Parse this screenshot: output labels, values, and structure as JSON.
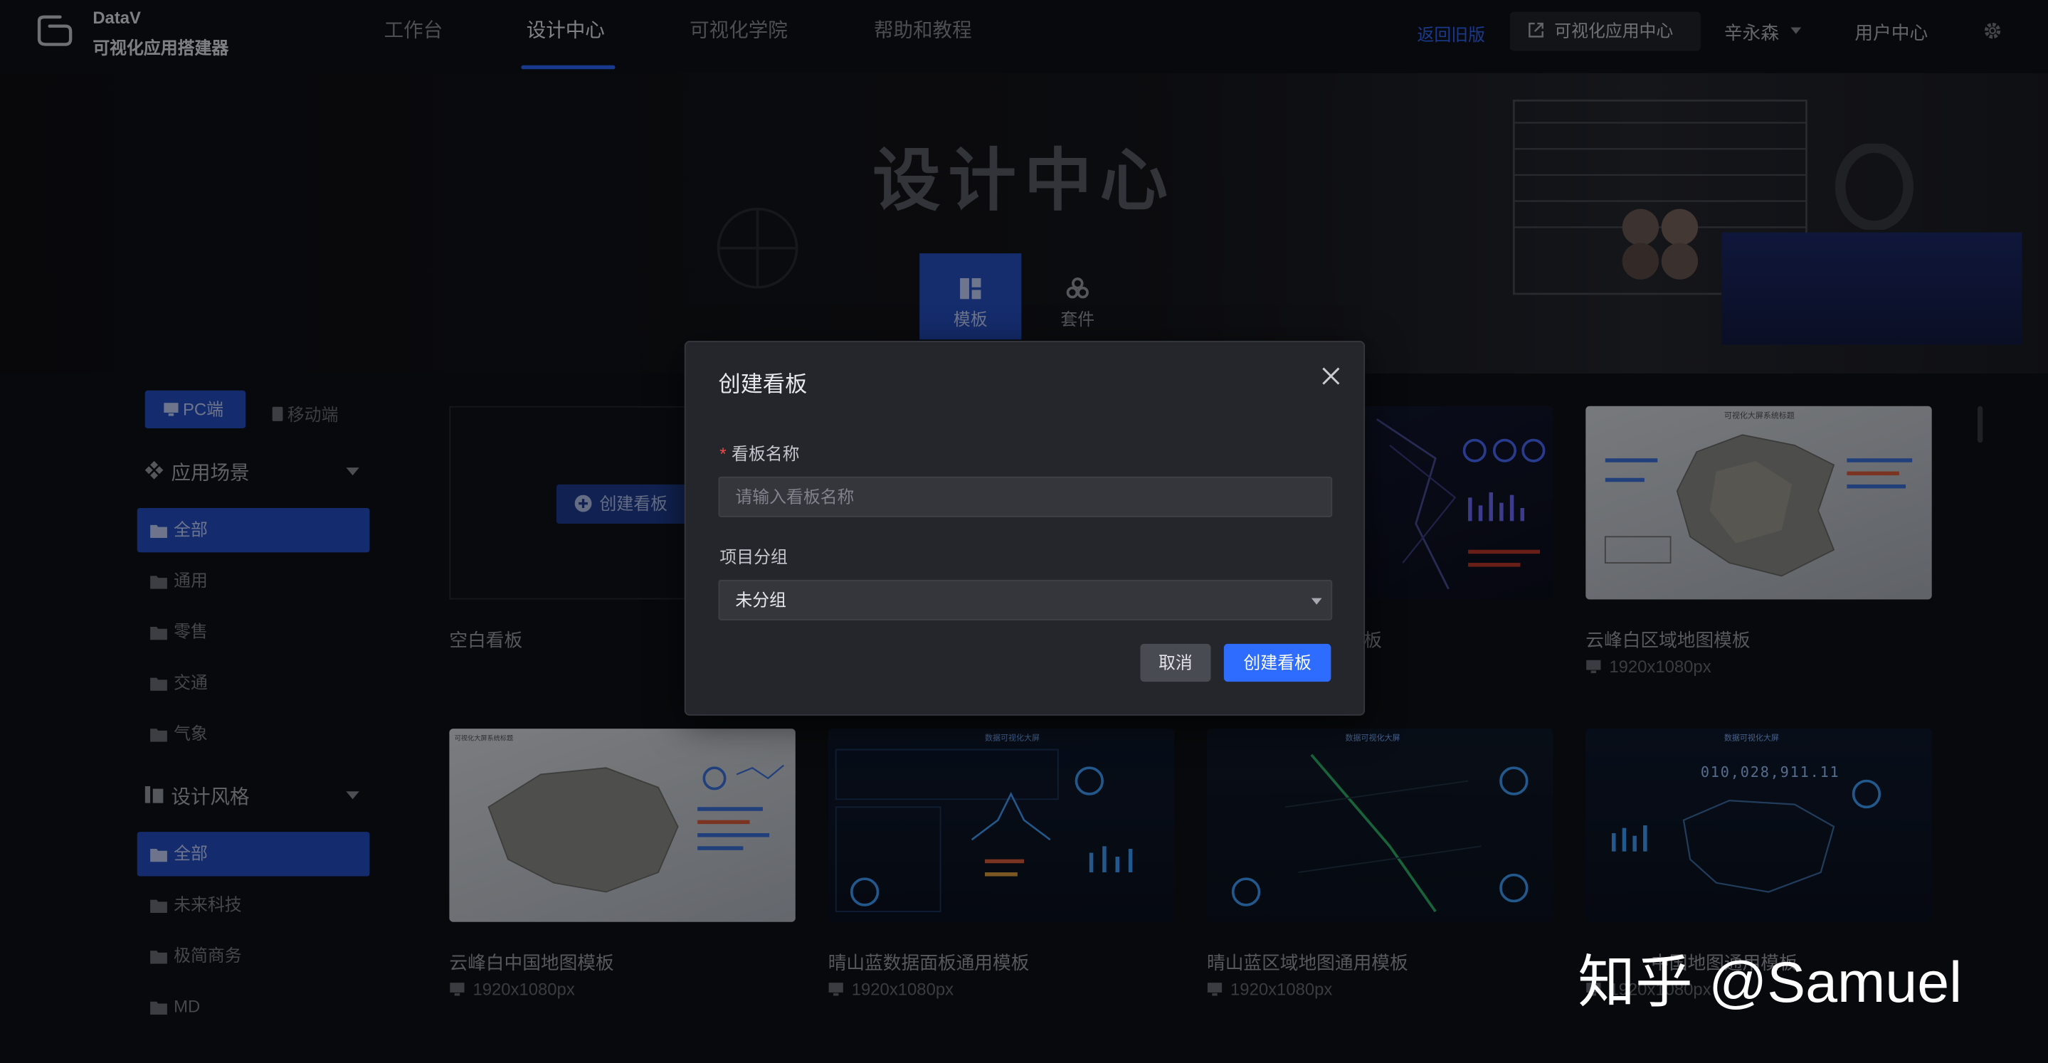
{
  "header": {
    "brand_name": "DataV",
    "brand_sub": "可视化应用搭建器",
    "nav": [
      {
        "label": "工作台"
      },
      {
        "label": "设计中心",
        "active": true
      },
      {
        "label": "可视化学院"
      },
      {
        "label": "帮助和教程"
      }
    ],
    "back_old": "返回旧版",
    "vis_center": "可视化应用中心",
    "user_name": "辛永森",
    "user_center": "用户中心",
    "icons": {
      "logo": "datav-logo-icon",
      "external": "external-link-icon",
      "settings": "gear-icon"
    }
  },
  "hero": {
    "title": "设计中心",
    "tabs": [
      {
        "label": "模板",
        "icon": "template-icon",
        "active": true
      },
      {
        "label": "套件",
        "icon": "kit-icon"
      }
    ]
  },
  "sidebar": {
    "platform": {
      "pc": "PC端",
      "mobile": "移动端"
    },
    "scene_title": "应用场景",
    "scene_items": [
      "全部",
      "通用",
      "零售",
      "交通",
      "气象"
    ],
    "style_title": "设计风格",
    "style_items": [
      "全部",
      "未来科技",
      "极简商务",
      "MD"
    ]
  },
  "cards": {
    "blank": {
      "create_label": "创建看板",
      "title": "空白看板"
    },
    "row1": [
      {
        "title": "板",
        "size": ""
      },
      {
        "title": "云峰白区域地图模板",
        "size": "1920x1080px"
      }
    ],
    "row2": [
      {
        "title": "云峰白中国地图模板",
        "size": "1920x1080px"
      },
      {
        "title": "晴山蓝数据面板通用模板",
        "size": "1920x1080px"
      },
      {
        "title": "晴山蓝区域地图通用模板",
        "size": "1920x1080px"
      },
      {
        "title": "中国地图通用模板",
        "size": "1920x1080px"
      }
    ],
    "thumb_texts": {
      "map_title": "可视化大屏系统标题",
      "dash_title": "数据可视化大屏",
      "big_number": "010,028,911.11"
    }
  },
  "modal": {
    "title": "创建看板",
    "name_label": "看板名称",
    "name_placeholder": "请输入看板名称",
    "name_value": "",
    "group_label": "项目分组",
    "group_value": "未分组",
    "cancel": "取消",
    "confirm": "创建看板"
  },
  "watermark": "知乎 @Samuel",
  "colors": {
    "accent": "#2e6bff",
    "active_bg": "#2650c8",
    "background": "#101116",
    "modal_bg": "#25262b"
  }
}
